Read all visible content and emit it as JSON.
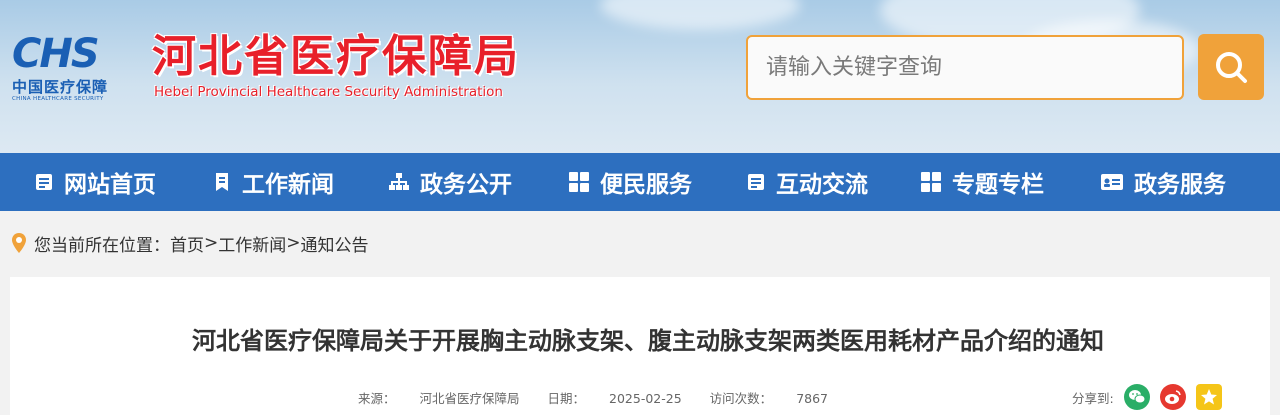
{
  "header": {
    "logo_mark": "CHS",
    "logo_cn": "中国医疗保障",
    "logo_en": "CHINA HEALTHCARE SECURITY",
    "site_title": "河北省医疗保障局",
    "site_subtitle": "Hebei Provincial Healthcare Security Administration"
  },
  "search": {
    "placeholder": "请输入关键字查询",
    "value": "",
    "icon": "search-icon"
  },
  "nav": {
    "items": [
      {
        "label": "网站首页",
        "icon": "document-icon"
      },
      {
        "label": "工作新闻",
        "icon": "bookmark-icon"
      },
      {
        "label": "政务公开",
        "icon": "sitemap-icon"
      },
      {
        "label": "便民服务",
        "icon": "grid-icon"
      },
      {
        "label": "互动交流",
        "icon": "document-icon"
      },
      {
        "label": "专题专栏",
        "icon": "grid-icon"
      },
      {
        "label": "政务服务",
        "icon": "id-card-icon"
      }
    ]
  },
  "breadcrumb": {
    "prefix": "您当前所在位置：",
    "items": [
      "首页",
      "工作新闻",
      "通知公告"
    ],
    "separator": ">"
  },
  "article": {
    "title": "河北省医疗保障局关于开展胸主动脉支架、腹主动脉支架两类医用耗材产品介绍的通知",
    "source_label": "来源：",
    "source": "河北省医疗保障局",
    "date_label": "日期：",
    "date": "2025-02-25",
    "views_label": "访问次数：",
    "views": "7867"
  },
  "share": {
    "label": "分享到:",
    "targets": [
      "wechat-icon",
      "weibo-icon",
      "qzone-icon"
    ]
  },
  "colors": {
    "nav_bg": "#2d6fbf",
    "accent_orange": "#f0a23a",
    "title_red": "#e8202a",
    "brand_blue": "#1a5fb4"
  }
}
